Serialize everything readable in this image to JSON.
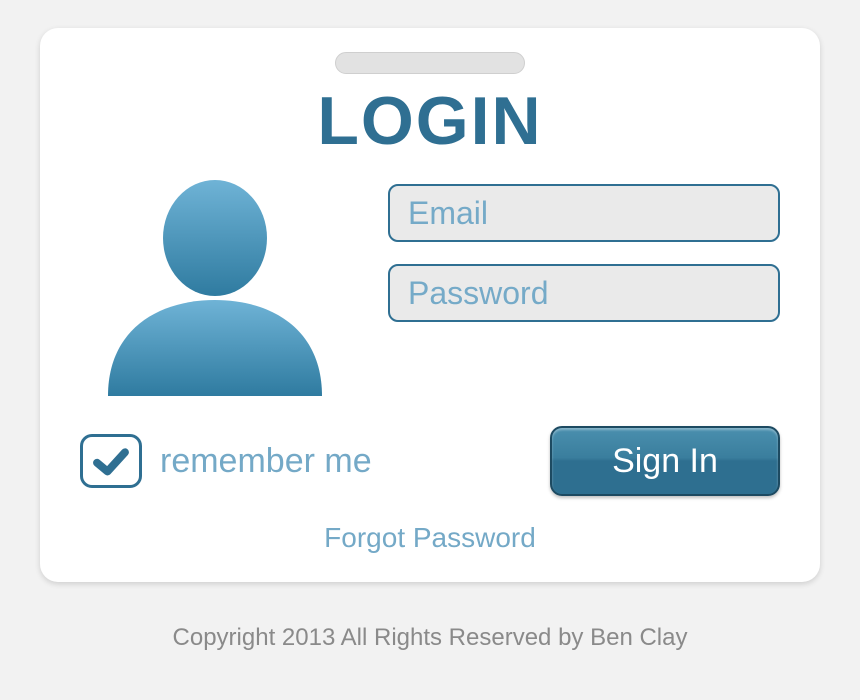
{
  "card": {
    "title": "LOGIN",
    "email": {
      "placeholder": "Email",
      "value": ""
    },
    "password": {
      "placeholder": "Password",
      "value": ""
    },
    "remember_label": "remember me",
    "remember_checked": true,
    "signin_label": "Sign In",
    "forgot_label": "Forgot Password"
  },
  "footer": {
    "copyright": "Copyright 2013 All Rights Reserved by Ben Clay"
  },
  "colors": {
    "brand": "#2f6f92",
    "accent_light": "#74a9c7",
    "field_bg": "#eaeaea"
  }
}
